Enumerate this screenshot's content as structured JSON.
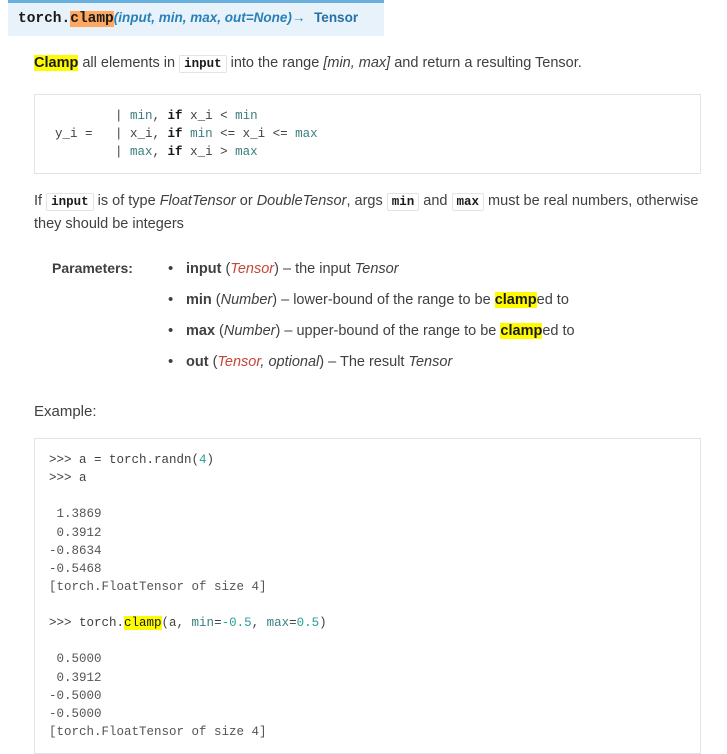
{
  "signature": {
    "module": "torch.",
    "function": "clamp",
    "params": "(input, min, max, out=None)",
    "arrow": "→",
    "return_type": "Tensor"
  },
  "description": {
    "highlight_word": "Clamp",
    "text_1": " all elements in ",
    "code_input": "input",
    "text_2": " into the range ",
    "range": "[min, max]",
    "text_3": " and return a resulting Tensor."
  },
  "formula_block": {
    "line1_lhs": "        ",
    "lines": [
      {
        "prefix": "        | ",
        "val": "min",
        "mid": ", ",
        "kw": "if",
        "expr_a": " x_i < ",
        "val2": "min"
      },
      {
        "prefix": "y_i =   | ",
        "val": "x_i",
        "mid": ", ",
        "kw": "if",
        "expr_a": " ",
        "val2": "min",
        "expr_b": " <= x_i <= ",
        "val3": "max"
      },
      {
        "prefix": "        | ",
        "val": "max",
        "mid": ", ",
        "kw": "if",
        "expr_a": " x_i > ",
        "val2": "max"
      }
    ]
  },
  "type_note": {
    "lead": "If ",
    "code_input": "input",
    "text_1": " is of type ",
    "type_a": "FloatTensor",
    "text_2": " or ",
    "type_b": "DoubleTensor",
    "text_3": ", args ",
    "code_min": "min",
    "text_4": " and ",
    "code_max": "max",
    "text_5": " must be real numbers, otherwise they should be integers"
  },
  "parameters": {
    "label": "Parameters:",
    "items": [
      {
        "name": "input",
        "type": "Tensor",
        "optional": "",
        "dash": " – ",
        "desc_pre": "the input ",
        "desc_em": "Tensor",
        "desc_hl": "",
        "desc_post": ""
      },
      {
        "name": "min",
        "type": "Number",
        "optional": "",
        "dash": " – ",
        "desc_pre": "lower-bound of the range to be ",
        "desc_em": "",
        "desc_hl": "clamp",
        "desc_post": "ed to"
      },
      {
        "name": "max",
        "type": "Number",
        "optional": "",
        "dash": " – ",
        "desc_pre": "upper-bound of the range to be ",
        "desc_em": "",
        "desc_hl": "clamp",
        "desc_post": "ed to"
      },
      {
        "name": "out",
        "type": "Tensor",
        "optional": ", optional",
        "dash": " – ",
        "desc_pre": "The result ",
        "desc_em": "Tensor",
        "desc_hl": "",
        "desc_post": ""
      }
    ]
  },
  "example": {
    "label": "Example:",
    "block": {
      "prompt_1": ">>> a = torch.randn(",
      "arg_1": "4",
      "prompt_1_end": ")",
      "prompt_2": ">>> a",
      "output_1": [
        " 1.3869",
        " 0.3912",
        "-0.8634",
        "-0.5468",
        "[torch.FloatTensor of size 4]"
      ],
      "prompt_3_pre": ">>> torch.",
      "prompt_3_hl": "clamp",
      "prompt_3_open": "(a, ",
      "kw_min": "min",
      "eq_1": "=",
      "num_min": "-0.5",
      "comma": ", ",
      "kw_max": "max",
      "eq_2": "=",
      "num_max": "0.5",
      "close": ")",
      "output_2": [
        " 0.5000",
        " 0.3912",
        "-0.5000",
        "-0.5000",
        "[torch.FloatTensor of size 4]"
      ]
    }
  },
  "colors": {
    "header_bg": "#e7f2fa",
    "header_rule": "#6ab0de",
    "fn_highlight": "#ffa75e",
    "text_highlight": "#fffb00",
    "param_type": "#c7463a",
    "code_keyword": "#3a7d7d",
    "code_number": "#2aa198",
    "link_blue": "#2980b9",
    "border": "#e1e4e5",
    "text": "#404040"
  }
}
